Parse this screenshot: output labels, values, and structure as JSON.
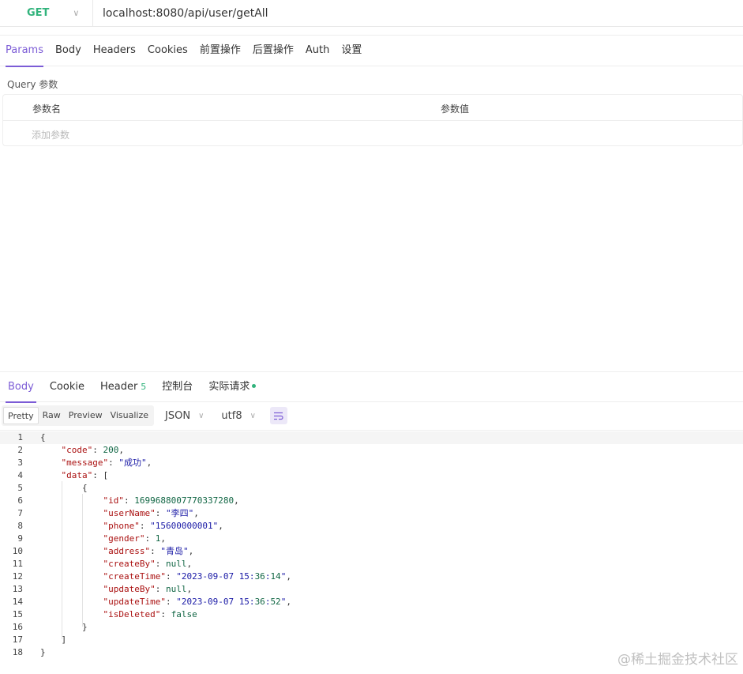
{
  "request": {
    "method": "GET",
    "url": "localhost:8080/api/user/getAll",
    "tabs": [
      "Params",
      "Body",
      "Headers",
      "Cookies",
      "前置操作",
      "后置操作",
      "Auth",
      "设置"
    ],
    "active_tab": "Params",
    "query_label": "Query 参数",
    "param_table": {
      "col_name": "参数名",
      "col_value": "参数值",
      "add_placeholder": "添加参数"
    }
  },
  "response": {
    "tabs": [
      {
        "label": "Body"
      },
      {
        "label": "Cookie"
      },
      {
        "label": "Header",
        "badge": "5"
      },
      {
        "label": "控制台"
      },
      {
        "label": "实际请求",
        "dot": true
      }
    ],
    "active_tab": "Body",
    "view_modes": [
      "Pretty",
      "Raw",
      "Preview",
      "Visualize"
    ],
    "active_view": "Pretty",
    "format": "JSON",
    "encoding": "utf8",
    "code_lines": [
      "{",
      "    \"code\": 200,",
      "    \"message\": \"成功\",",
      "    \"data\": [",
      "        {",
      "            \"id\": 1699688007770337280,",
      "            \"userName\": \"李四\",",
      "            \"phone\": \"15600000001\",",
      "            \"gender\": 1,",
      "            \"address\": \"青岛\",",
      "            \"createBy\": null,",
      "            \"createTime\": \"2023-09-07 15:36:14\",",
      "            \"updateBy\": null,",
      "            \"updateTime\": \"2023-09-07 15:36:52\",",
      "            \"isDeleted\": false",
      "        }",
      "    ]",
      "}"
    ]
  },
  "watermark": "@稀土掘金技术社区",
  "colors": {
    "accent": "#7c5cd6",
    "method_get": "#31b37c"
  }
}
